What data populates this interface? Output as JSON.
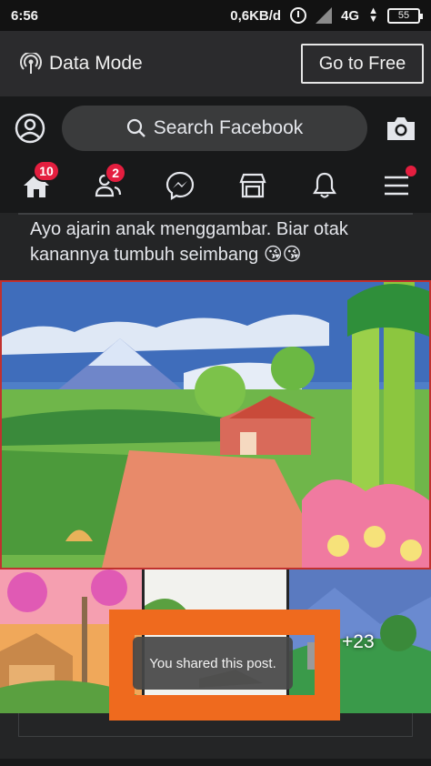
{
  "status_bar": {
    "time": "6:56",
    "net_speed": "0,6KB/d",
    "network": "4G",
    "battery": "55"
  },
  "data_mode": {
    "label": "Data Mode",
    "go_free_button": "Go to Free"
  },
  "header": {
    "search_placeholder": "Search Facebook"
  },
  "nav": {
    "home_badge": "10",
    "friends_badge": "2"
  },
  "post": {
    "text": "Ayo ajarin anak menggambar. Biar otak kanannya tumbuh seimbang 😘😘",
    "more_photos": "+23"
  },
  "toast": {
    "message": "You shared this post."
  },
  "colors": {
    "background": "#18191a",
    "toast_frame": "#ef6a1e",
    "badge": "#e41e3f"
  }
}
